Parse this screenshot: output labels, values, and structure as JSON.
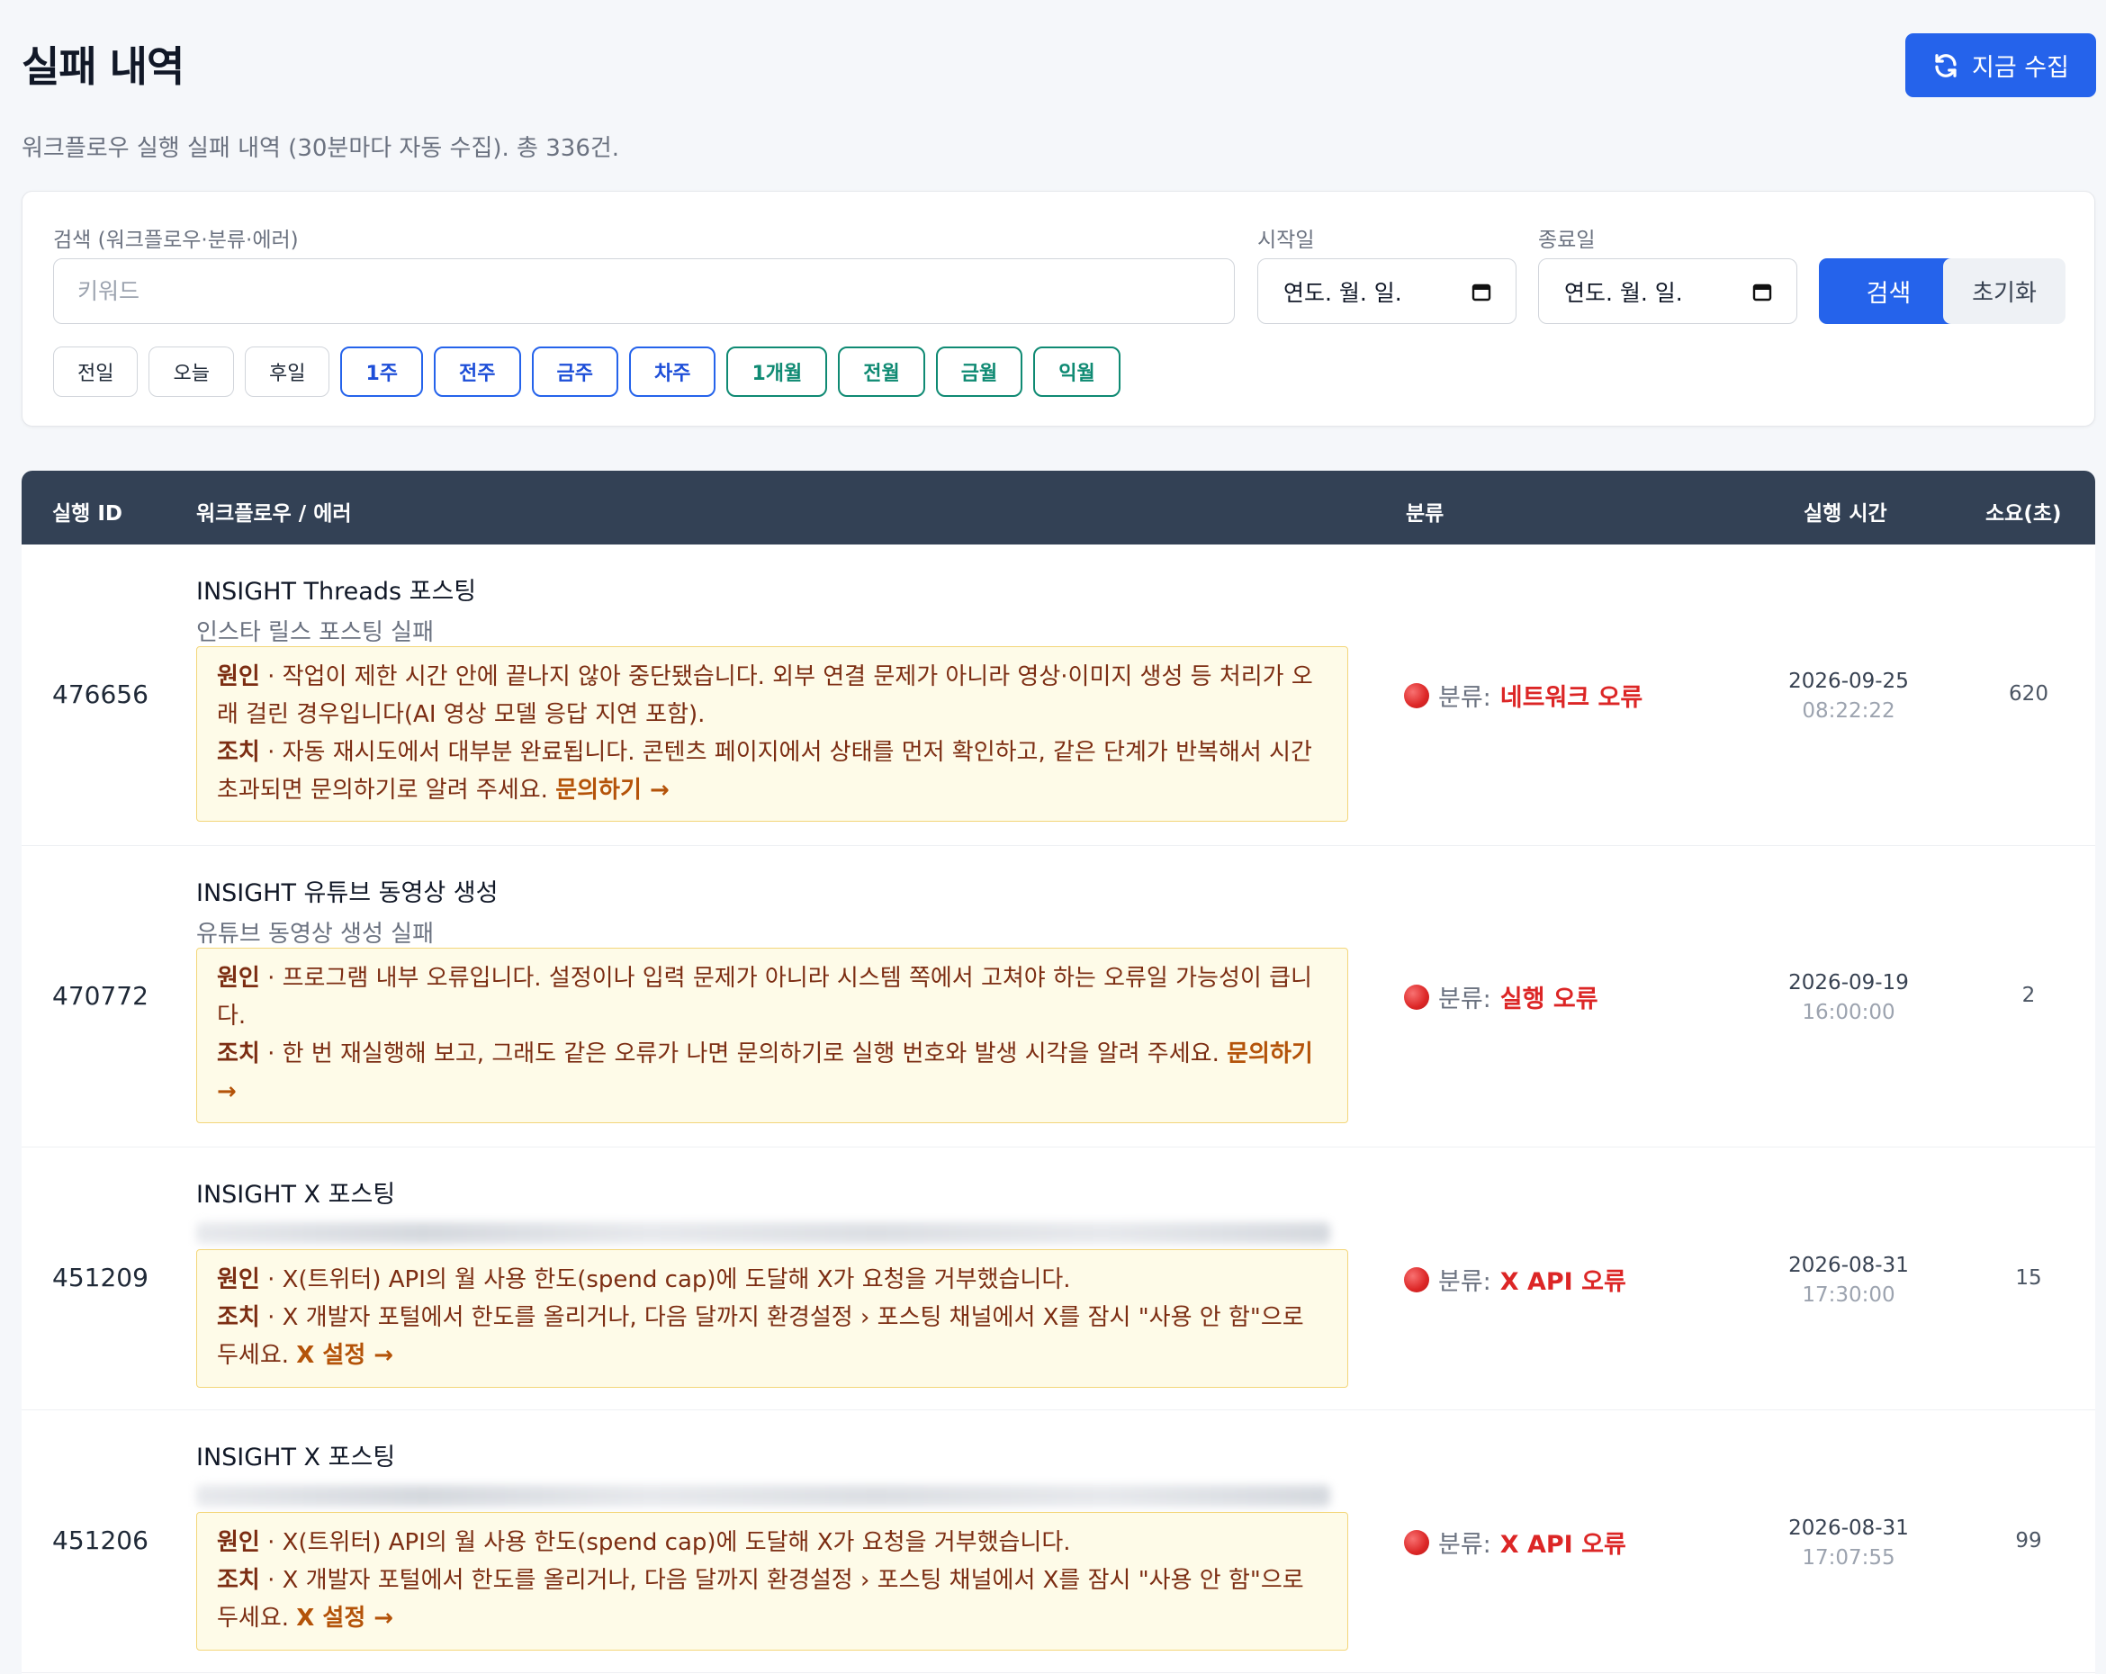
{
  "header": {
    "title": "실패 내역",
    "collect_button": "지금 수집",
    "subtitle": "워크플로우 실행 실패 내역 (30분마다 자동 수집). 총 336건."
  },
  "filters": {
    "search_label": "검색 (워크플로우·분류·에러)",
    "search_placeholder": "키워드",
    "start_label": "시작일",
    "start_value": "연도. 월. 일.",
    "end_label": "종료일",
    "end_value": "연도. 월. 일.",
    "search_button": "검색",
    "reset_button": "초기화",
    "chips": [
      "전일",
      "오늘",
      "후일",
      "1주",
      "전주",
      "금주",
      "차주",
      "1개월",
      "전월",
      "금월",
      "익월"
    ]
  },
  "table": {
    "headers": {
      "id": "실행 ID",
      "workflow": "워크플로우 / 에러",
      "category": "분류",
      "time": "실행 시간",
      "duration": "소요(초)"
    },
    "cause_label": "원인",
    "action_label": "조치",
    "category_prefix": "분류:",
    "rows": [
      {
        "id": "476656",
        "workflow": "INSIGHT Threads 포스팅",
        "sub": "인스타 릴스 포스팅 실패",
        "cause": " · 작업이 제한 시간 안에 끝나지 않아 중단됐습니다. 외부 연결 문제가 아니라 영상·이미지 생성 등 처리가 오래 걸린 경우입니다(AI 영상 모델 응답 지연 포함).",
        "action": " · 자동 재시도에서 대부분 완료됩니다. 콘텐츠 페이지에서 상태를 먼저 확인하고, 같은 단계가 반복해서 시간 초과되면 문의하기로 알려 주세요. ",
        "link": "문의하기 →",
        "category": "네트워크 오류",
        "date": "2026-09-25",
        "time": "08:22:22",
        "duration": "620"
      },
      {
        "id": "470772",
        "workflow": "INSIGHT 유튜브 동영상 생성",
        "sub": "유튜브 동영상 생성 실패",
        "cause": " · 프로그램 내부 오류입니다. 설정이나 입력 문제가 아니라 시스템 쪽에서 고쳐야 하는 오류일 가능성이 큽니다.",
        "action": " · 한 번 재실행해 보고, 그래도 같은 오류가 나면 문의하기로 실행 번호와 발생 시각을 알려 주세요. ",
        "link": "문의하기 →",
        "category": "실행 오류",
        "date": "2026-09-19",
        "time": "16:00:00",
        "duration": "2"
      },
      {
        "id": "451209",
        "workflow": "INSIGHT X 포스팅",
        "sub": "",
        "cause": " · X(트위터) API의 월 사용 한도(spend cap)에 도달해 X가 요청을 거부했습니다.",
        "action": " · X 개발자 포털에서 한도를 올리거나, 다음 달까지 환경설정 › 포스팅 채널에서 X를 잠시 \"사용 안 함\"으로 두세요. ",
        "link": "X 설정 →",
        "category": "X API 오류",
        "date": "2026-08-31",
        "time": "17:30:00",
        "duration": "15"
      },
      {
        "id": "451206",
        "workflow": "INSIGHT X 포스팅",
        "sub": "",
        "cause": " · X(트위터) API의 월 사용 한도(spend cap)에 도달해 X가 요청을 거부했습니다.",
        "action": " · X 개발자 포털에서 한도를 올리거나, 다음 달까지 환경설정 › 포스팅 채널에서 X를 잠시 \"사용 안 함\"으로 두세요. ",
        "link": "X 설정 →",
        "category": "X API 오류",
        "date": "2026-08-31",
        "time": "17:07:55",
        "duration": "99"
      }
    ]
  },
  "colors": {
    "primary": "#2563eb",
    "header_bg": "#334155",
    "error_red": "#dc2626",
    "note_bg": "#fefbe8",
    "note_border": "#f3d67a",
    "link_orange": "#b45309",
    "chip_teal": "#0f8a73"
  },
  "icons": {
    "collect": "refresh-icon",
    "date": "calendar-icon",
    "category": "red-circle-icon"
  }
}
